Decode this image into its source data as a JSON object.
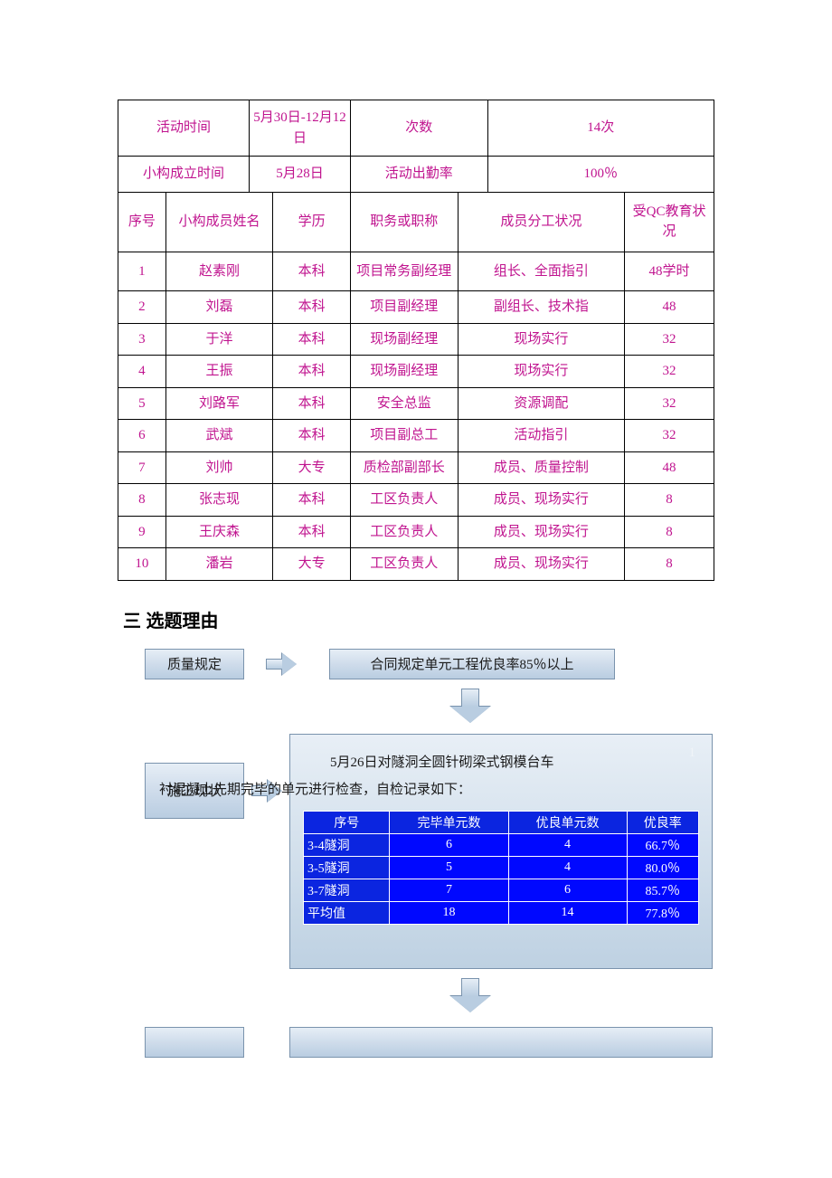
{
  "summary": {
    "activity_time_label": "活动时间",
    "activity_time_value": "5月30日-12月12日",
    "times_label": "次数",
    "times_value": "14次",
    "formation_label": "小构成立时间",
    "formation_value": "5月28日",
    "attendance_label": "活动出勤率",
    "attendance_value": "100％"
  },
  "columns": {
    "seq": "序号",
    "name": "小构成员姓名",
    "edu": "学历",
    "title": "职务或职称",
    "role": "成员分工状况",
    "qc": "受QC教育状况"
  },
  "members": [
    {
      "seq": "1",
      "name": "赵素刚",
      "edu": "本科",
      "title": "项目常务副经理",
      "role": "组长、全面指引",
      "qc": "48学时"
    },
    {
      "seq": "2",
      "name": "刘磊",
      "edu": "本科",
      "title": "项目副经理",
      "role": "副组长、技术指",
      "qc": "48"
    },
    {
      "seq": "3",
      "name": "于洋",
      "edu": "本科",
      "title": "现场副经理",
      "role": "现场实行",
      "qc": "32"
    },
    {
      "seq": "4",
      "name": "王振",
      "edu": "本科",
      "title": "现场副经理",
      "role": "现场实行",
      "qc": "32"
    },
    {
      "seq": "5",
      "name": "刘路军",
      "edu": "本科",
      "title": "安全总监",
      "role": "资源调配",
      "qc": "32"
    },
    {
      "seq": "6",
      "name": "武斌",
      "edu": "本科",
      "title": "项目副总工",
      "role": "活动指引",
      "qc": "32"
    },
    {
      "seq": "7",
      "name": "刘帅",
      "edu": "大专",
      "title": "质检部副部长",
      "role": "成员、质量控制",
      "qc": "48"
    },
    {
      "seq": "8",
      "name": "张志现",
      "edu": "本科",
      "title": "工区负责人",
      "role": "成员、现场实行",
      "qc": "8"
    },
    {
      "seq": "9",
      "name": "王庆森",
      "edu": "本科",
      "title": "工区负责人",
      "role": "成员、现场实行",
      "qc": "8"
    },
    {
      "seq": "10",
      "name": "潘岩",
      "edu": "大专",
      "title": "工区负责人",
      "role": "成员、现场实行",
      "qc": "8"
    }
  ],
  "section_title": "三 选题理由",
  "flow": {
    "quality_label": "质量规定",
    "contract_text": "合同规定单元工程优良率85％以上",
    "status_label": "施工现状",
    "panel_pagenum": "1",
    "panel_text_line1": "5月26日对隧洞全圆针砌梁式钢模台车",
    "panel_text_line2": "衬混凝土先期完毕的单元进行检查，自检记录如下：",
    "inner": {
      "headers": [
        "序号",
        "完毕单元数",
        "优良单元数",
        "优良率"
      ],
      "rows": [
        {
          "cat": "3-4隧洞",
          "a": "6",
          "b": "4",
          "c": "66.7％"
        },
        {
          "cat": "3-5隧洞",
          "a": "5",
          "b": "4",
          "c": "80.0％"
        },
        {
          "cat": "3-7隧洞",
          "a": "7",
          "b": "6",
          "c": "85.7％"
        },
        {
          "cat": "平均值",
          "a": "18",
          "b": "14",
          "c": "77.8％"
        }
      ]
    }
  },
  "chart_data": {
    "type": "table",
    "title": "自检记录",
    "columns": [
      "序号",
      "完毕单元数",
      "优良单元数",
      "优良率"
    ],
    "rows": [
      [
        "3-4隧洞",
        6,
        4,
        "66.7％"
      ],
      [
        "3-5隧洞",
        5,
        4,
        "80.0％"
      ],
      [
        "3-7隧洞",
        7,
        6,
        "85.7％"
      ],
      [
        "平均值",
        18,
        14,
        "77.8％"
      ]
    ]
  }
}
